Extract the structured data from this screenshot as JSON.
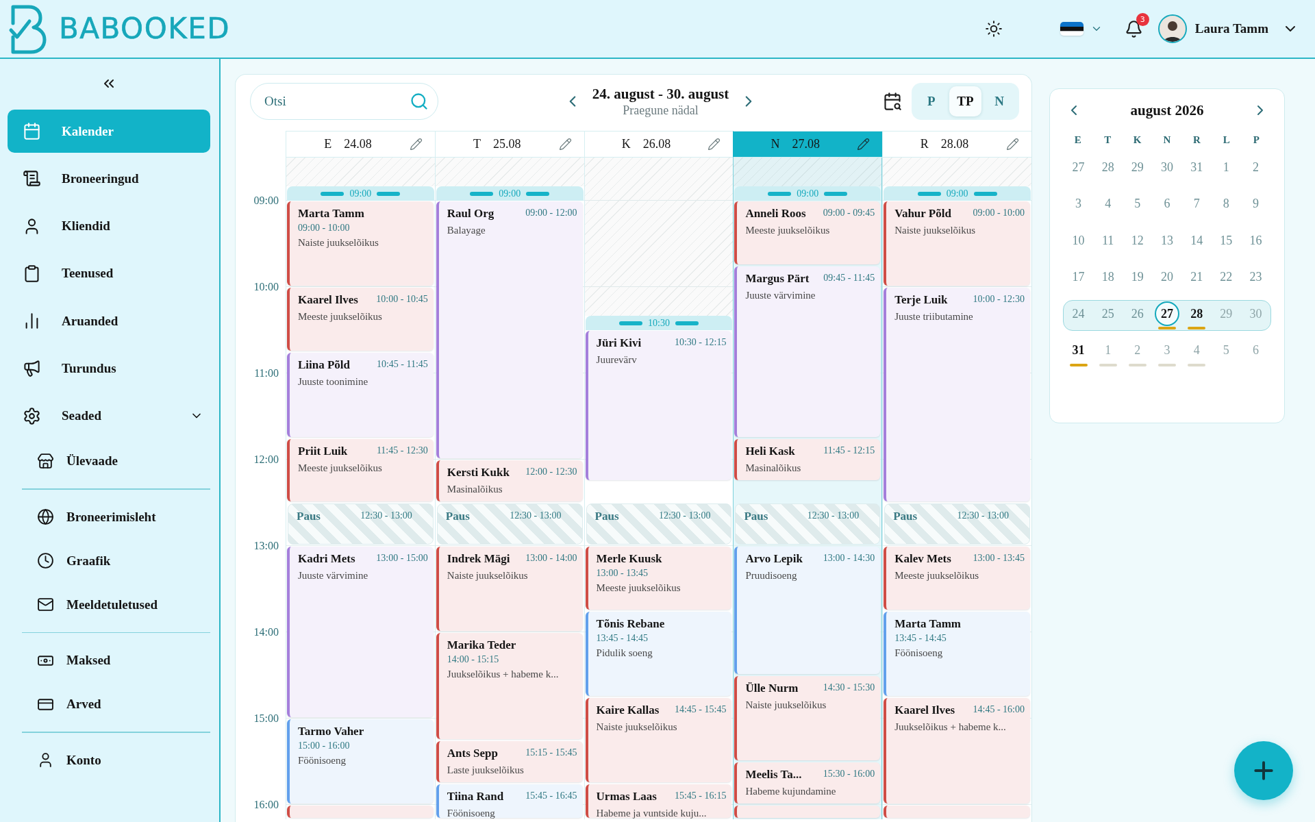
{
  "header": {
    "brand": "BABOOKED",
    "notifications": {
      "count": "3"
    },
    "user": {
      "name": "Laura Tamm"
    }
  },
  "sidebar": {
    "items": [
      {
        "label": "Kalender",
        "selected": true
      },
      {
        "label": "Broneeringud",
        "selected": false
      },
      {
        "label": "Kliendid",
        "selected": false
      },
      {
        "label": "Teenused",
        "selected": false
      },
      {
        "label": "Aruanded",
        "selected": false
      },
      {
        "label": "Turundus",
        "selected": false
      },
      {
        "label": "Seaded",
        "selected": false,
        "expanded": true,
        "children": [
          {
            "items": [
              {
                "label": "Ülevaade",
                "selected": false
              }
            ]
          },
          {
            "items": [
              {
                "label": "Broneerimisleht",
                "selected": false
              },
              {
                "label": "Graafik",
                "selected": false
              },
              {
                "label": "Meeldetuletused",
                "selected": false
              }
            ]
          },
          {
            "items": [
              {
                "label": "Maksed",
                "selected": false
              },
              {
                "label": "Arved",
                "selected": false
              }
            ]
          },
          {
            "items": [
              {
                "label": "Konto",
                "selected": false
              }
            ]
          }
        ]
      }
    ]
  },
  "calendar": {
    "search": {
      "placeholder": "Otsi"
    },
    "week": {
      "title": "24. august - 30. august",
      "subtitle": "Praegune nädal"
    },
    "views": [
      {
        "label": "P",
        "selected": false
      },
      {
        "label": "TP",
        "selected": true
      },
      {
        "label": "N",
        "selected": false
      }
    ],
    "hours": [
      "09:00",
      "10:00",
      "11:00",
      "12:00",
      "13:00",
      "14:00",
      "15:00",
      "16:00"
    ],
    "days": [
      {
        "weekday": "E",
        "date": "24.08",
        "today": false,
        "opening": "09:00",
        "events": [
          {
            "kind": "stacked",
            "client": "Marta Tamm",
            "time": "09:00 - 10:00",
            "service": "Naiste juukselõikus",
            "color": "#cf4d46"
          },
          {
            "kind": "inline",
            "client": "Kaarel Ilves",
            "time": "10:00 - 10:45",
            "service": "Meeste juukselõikus",
            "color": "#cf4d46"
          },
          {
            "kind": "inline",
            "client": "Liina Põld",
            "time": "10:45 - 11:45",
            "service": "Juuste toonimine",
            "color": "#a47fdb"
          },
          {
            "kind": "inline",
            "client": "Priit Luik",
            "time": "11:45 - 12:30",
            "service": "Meeste juukselõikus",
            "color": "#cf4d46"
          },
          {
            "kind": "break",
            "label": "Paus",
            "time": "12:30 - 13:00"
          },
          {
            "kind": "inline",
            "client": "Kadri Mets",
            "time": "13:00 - 15:00",
            "service": "Juuste värvimine",
            "color": "#a47fdb"
          },
          {
            "kind": "stacked",
            "client": "Tarmo Vaher",
            "time": "15:00 - 16:00",
            "service": "Föönisoeng",
            "color": "#62a0ec"
          },
          {
            "kind": "stub",
            "color": "#cf4d46"
          }
        ]
      },
      {
        "weekday": "T",
        "date": "25.08",
        "today": false,
        "opening": "09:00",
        "events": [
          {
            "kind": "inline",
            "client": "Raul Org",
            "time": "09:00 - 12:00",
            "service": "Balayage",
            "color": "#a47fdb"
          },
          {
            "kind": "inline",
            "client": "Kersti Kukk",
            "time": "12:00 - 12:30",
            "service": "Masinalõikus",
            "color": "#cf4d46"
          },
          {
            "kind": "break",
            "label": "Paus",
            "time": "12:30 - 13:00"
          },
          {
            "kind": "inline",
            "client": "Indrek Mägi",
            "time": "13:00 - 14:00",
            "service": "Naiste juukselõikus",
            "color": "#cf4d46"
          },
          {
            "kind": "stacked",
            "client": "Marika Teder",
            "time": "14:00 - 15:15",
            "service": "Juukselõikus + habeme k...",
            "color": "#cf4d46"
          },
          {
            "kind": "inline",
            "client": "Ants Sepp",
            "time": "15:15 - 15:45",
            "service": "Laste juukselõikus",
            "color": "#cf4d46"
          },
          {
            "kind": "inline",
            "client": "Tiina Rand",
            "time": "15:45 - 16:45",
            "service": "Föönisoeng",
            "color": "#62a0ec"
          }
        ]
      },
      {
        "weekday": "K",
        "date": "26.08",
        "today": false,
        "opening": "10:30",
        "events": [
          {
            "kind": "inline",
            "client": "Jüri Kivi",
            "time": "10:30 - 12:15",
            "service": "Juurevärv",
            "color": "#a47fdb"
          },
          {
            "kind": "break",
            "label": "Paus",
            "time": "12:30 - 13:00"
          },
          {
            "kind": "stacked",
            "client": "Merle Kuusk",
            "time": "13:00 - 13:45",
            "service": "Meeste juukselõikus",
            "color": "#cf4d46"
          },
          {
            "kind": "stacked",
            "client": "Tõnis Rebane",
            "time": "13:45 - 14:45",
            "service": "Pidulik soeng",
            "color": "#62a0ec"
          },
          {
            "kind": "inline",
            "client": "Kaire Kallas",
            "time": "14:45 - 15:45",
            "service": "Naiste juukselõikus",
            "color": "#cf4d46"
          },
          {
            "kind": "inline",
            "client": "Urmas Laas",
            "time": "15:45 - 16:15",
            "service": "Habeme ja vuntside kuju...",
            "color": "#cf4d46"
          }
        ]
      },
      {
        "weekday": "N",
        "date": "27.08",
        "today": true,
        "opening": "09:00",
        "events": [
          {
            "kind": "inline",
            "client": "Anneli Roos",
            "time": "09:00 - 09:45",
            "service": "Meeste juukselõikus",
            "color": "#cf4d46"
          },
          {
            "kind": "inline",
            "client": "Margus Pärt",
            "time": "09:45 - 11:45",
            "service": "Juuste värvimine",
            "color": "#a47fdb"
          },
          {
            "kind": "inline",
            "client": "Heli Kask",
            "time": "11:45 - 12:15",
            "service": "Masinalõikus",
            "color": "#cf4d46"
          },
          {
            "kind": "break",
            "label": "Paus",
            "time": "12:30 - 13:00"
          },
          {
            "kind": "inline",
            "client": "Arvo Lepik",
            "time": "13:00 - 14:30",
            "service": "Pruudisoeng",
            "color": "#62a0ec"
          },
          {
            "kind": "inline",
            "client": "Ülle Nurm",
            "time": "14:30 - 15:30",
            "service": "Naiste juukselõikus",
            "color": "#cf4d46"
          },
          {
            "kind": "inline",
            "client": "Meelis Ta...",
            "time": "15:30 - 16:00",
            "service": "Habeme kujundamine",
            "color": "#cf4d46"
          },
          {
            "kind": "stub",
            "color": "#cf4d46"
          }
        ]
      },
      {
        "weekday": "R",
        "date": "28.08",
        "today": false,
        "opening": "09:00",
        "events": [
          {
            "kind": "inline",
            "client": "Vahur Põld",
            "time": "09:00 - 10:00",
            "service": "Naiste juukselõikus",
            "color": "#cf4d46"
          },
          {
            "kind": "inline",
            "client": "Terje Luik",
            "time": "10:00 - 12:30",
            "service": "Juuste triibutamine",
            "color": "#a47fdb"
          },
          {
            "kind": "break",
            "label": "Paus",
            "time": "12:30 - 13:00"
          },
          {
            "kind": "inline",
            "client": "Kalev Mets",
            "time": "13:00 - 13:45",
            "service": "Meeste juukselõikus",
            "color": "#cf4d46"
          },
          {
            "kind": "stacked",
            "client": "Marta Tamm",
            "time": "13:45 - 14:45",
            "service": "Föönisoeng",
            "color": "#62a0ec"
          },
          {
            "kind": "inline",
            "client": "Kaarel Ilves",
            "time": "14:45 - 16:00",
            "service": "Juukselõikus + habeme k...",
            "color": "#cf4d46"
          },
          {
            "kind": "stub",
            "color": "#cf4d46"
          }
        ]
      }
    ]
  },
  "mini_calendar": {
    "title": "august 2026",
    "weekdays": [
      "E",
      "T",
      "K",
      "N",
      "R",
      "L",
      "P"
    ],
    "weeks": [
      {
        "selected": false,
        "days": [
          {
            "day": "27",
            "kind": "past",
            "today": false
          },
          {
            "day": "28",
            "kind": "past",
            "today": false
          },
          {
            "day": "29",
            "kind": "past",
            "today": false
          },
          {
            "day": "30",
            "kind": "past",
            "today": false
          },
          {
            "day": "31",
            "kind": "past",
            "today": false
          },
          {
            "day": "1",
            "kind": "past",
            "today": false
          },
          {
            "day": "2",
            "kind": "past",
            "today": false
          }
        ]
      },
      {
        "selected": false,
        "days": [
          {
            "day": "3",
            "kind": "past",
            "today": false
          },
          {
            "day": "4",
            "kind": "past",
            "today": false
          },
          {
            "day": "5",
            "kind": "past",
            "today": false
          },
          {
            "day": "6",
            "kind": "past",
            "today": false
          },
          {
            "day": "7",
            "kind": "past",
            "today": false
          },
          {
            "day": "8",
            "kind": "past",
            "today": false
          },
          {
            "day": "9",
            "kind": "past",
            "today": false
          }
        ]
      },
      {
        "selected": false,
        "days": [
          {
            "day": "10",
            "kind": "past",
            "today": false
          },
          {
            "day": "11",
            "kind": "past",
            "today": false
          },
          {
            "day": "12",
            "kind": "past",
            "today": false
          },
          {
            "day": "13",
            "kind": "past",
            "today": false
          },
          {
            "day": "14",
            "kind": "past",
            "today": false
          },
          {
            "day": "15",
            "kind": "past",
            "today": false
          },
          {
            "day": "16",
            "kind": "past",
            "today": false
          }
        ]
      },
      {
        "selected": false,
        "days": [
          {
            "day": "17",
            "kind": "past",
            "today": false
          },
          {
            "day": "18",
            "kind": "past",
            "today": false
          },
          {
            "day": "19",
            "kind": "past",
            "today": false
          },
          {
            "day": "20",
            "kind": "past",
            "today": false
          },
          {
            "day": "21",
            "kind": "past",
            "today": false
          },
          {
            "day": "22",
            "kind": "past",
            "today": false
          },
          {
            "day": "23",
            "kind": "past",
            "today": false
          }
        ]
      },
      {
        "selected": true,
        "days": [
          {
            "day": "24",
            "kind": "past",
            "today": false
          },
          {
            "day": "25",
            "kind": "past",
            "today": false
          },
          {
            "day": "26",
            "kind": "past",
            "today": false
          },
          {
            "day": "27",
            "kind": "active",
            "today": true,
            "color": "#dba514"
          },
          {
            "day": "28",
            "kind": "active",
            "today": false,
            "color": "#dba514"
          },
          {
            "day": "29",
            "kind": "faded",
            "today": false
          },
          {
            "day": "30",
            "kind": "faded",
            "today": false
          }
        ]
      },
      {
        "selected": false,
        "days": [
          {
            "day": "31",
            "kind": "active",
            "today": false,
            "color": "#dba514"
          },
          {
            "day": "1",
            "kind": "faded",
            "today": false,
            "color": "#dedbcd"
          },
          {
            "day": "2",
            "kind": "faded",
            "today": false,
            "color": "#dedbcd"
          },
          {
            "day": "3",
            "kind": "faded",
            "today": false,
            "color": "#dedbcd"
          },
          {
            "day": "4",
            "kind": "faded",
            "today": false,
            "color": "#dedbcd"
          },
          {
            "day": "5",
            "kind": "faded",
            "today": false
          },
          {
            "day": "6",
            "kind": "faded",
            "today": false
          }
        ]
      }
    ]
  }
}
